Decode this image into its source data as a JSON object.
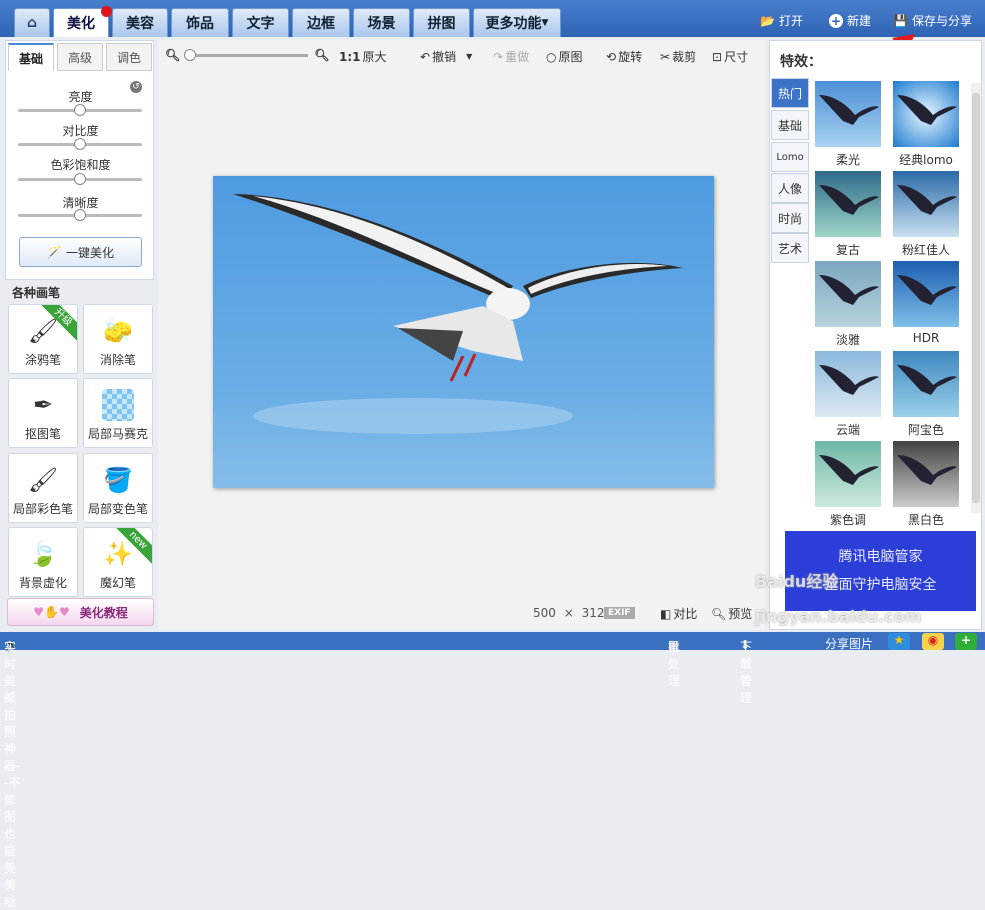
{
  "nav": {
    "home_icon": "home-icon",
    "tabs": [
      "美化",
      "美容",
      "饰品",
      "文字",
      "边框",
      "场景",
      "拼图",
      "更多功能"
    ],
    "open": "打开",
    "new": "新建",
    "save": "保存与分享"
  },
  "left": {
    "tabs": [
      "基础",
      "高级",
      "调色"
    ],
    "sliders": [
      "亮度",
      "对比度",
      "色彩饱和度",
      "清晰度"
    ],
    "auto": "一键美化",
    "brush_title": "各种画笔",
    "brushes": [
      {
        "label": "涂鸦笔",
        "badge": "升级"
      },
      {
        "label": "消除笔"
      },
      {
        "label": "抠图笔"
      },
      {
        "label": "局部马赛克"
      },
      {
        "label": "局部彩色笔"
      },
      {
        "label": "局部变色笔"
      },
      {
        "label": "背景虚化"
      },
      {
        "label": "魔幻笔",
        "badge": "new"
      }
    ],
    "tutorial": "美化教程"
  },
  "toolbar": {
    "ratio": "1:1",
    "original_size": "原大",
    "undo": "撤销",
    "redo": "重做",
    "original": "原图",
    "rotate": "旋转",
    "crop": "裁剪",
    "size": "尺寸"
  },
  "canvas": {
    "width": "500",
    "x": "×",
    "height": "312",
    "exif": "EXIF",
    "compare": "对比",
    "preview": "预览"
  },
  "effects": {
    "title": "特效：",
    "tabs": [
      "热门",
      "基础",
      "Lomo",
      "人像",
      "时尚",
      "艺术"
    ],
    "items": [
      "柔光",
      "经典lomo",
      "复古",
      "粉红佳人",
      "淡雅",
      "HDR",
      "云端",
      "阿宝色",
      "紫色调",
      "黑白色"
    ],
    "ad_line1": "腾讯电脑管家",
    "ad_line2": "全面守护电脑安全"
  },
  "status": {
    "tip": "实时美颜拍照神器--不修图也能美美哒",
    "batch": "批处理",
    "download": "下载管理",
    "share": "分享图片"
  },
  "watermark": "Baidu经验 jingyan.baidu.com"
}
